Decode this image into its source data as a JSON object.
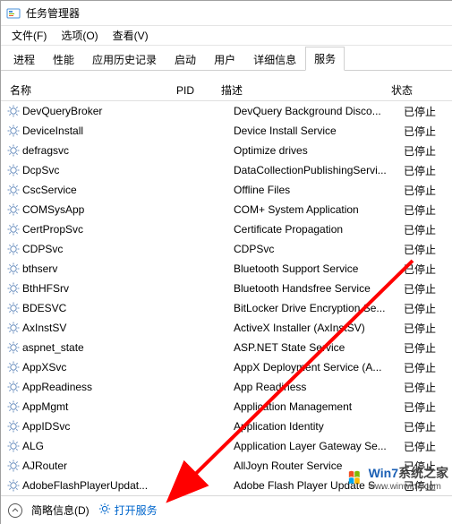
{
  "window": {
    "title": "任务管理器"
  },
  "menu": {
    "file": "文件(F)",
    "options": "选项(O)",
    "view": "查看(V)"
  },
  "tabs": {
    "processes": "进程",
    "performance": "性能",
    "history": "应用历史记录",
    "startup": "启动",
    "users": "用户",
    "details": "详细信息",
    "services": "服务"
  },
  "columns": {
    "name": "名称",
    "pid": "PID",
    "desc": "描述",
    "status": "状态"
  },
  "status_stopped": "已停止",
  "services": [
    {
      "name": "DevQueryBroker",
      "desc": "DevQuery Background Disco..."
    },
    {
      "name": "DeviceInstall",
      "desc": "Device Install Service"
    },
    {
      "name": "defragsvc",
      "desc": "Optimize drives"
    },
    {
      "name": "DcpSvc",
      "desc": "DataCollectionPublishingServi..."
    },
    {
      "name": "CscService",
      "desc": "Offline Files"
    },
    {
      "name": "COMSysApp",
      "desc": "COM+ System Application"
    },
    {
      "name": "CertPropSvc",
      "desc": "Certificate Propagation"
    },
    {
      "name": "CDPSvc",
      "desc": "CDPSvc"
    },
    {
      "name": "bthserv",
      "desc": "Bluetooth Support Service"
    },
    {
      "name": "BthHFSrv",
      "desc": "Bluetooth Handsfree Service"
    },
    {
      "name": "BDESVC",
      "desc": "BitLocker Drive Encryption Se..."
    },
    {
      "name": "AxInstSV",
      "desc": "ActiveX Installer (AxInstSV)"
    },
    {
      "name": "aspnet_state",
      "desc": "ASP.NET State Service"
    },
    {
      "name": "AppXSvc",
      "desc": "AppX Deployment Service (A..."
    },
    {
      "name": "AppReadiness",
      "desc": "App Readiness"
    },
    {
      "name": "AppMgmt",
      "desc": "Application Management"
    },
    {
      "name": "AppIDSvc",
      "desc": "Application Identity"
    },
    {
      "name": "ALG",
      "desc": "Application Layer Gateway Se..."
    },
    {
      "name": "AJRouter",
      "desc": "AllJoyn Router Service"
    },
    {
      "name": "AdobeFlashPlayerUpdat...",
      "desc": "Adobe Flash Player Update S..."
    }
  ],
  "statusbar": {
    "fewer": "简略信息(D)",
    "open_services": "打开服务"
  },
  "watermark": {
    "line1a": "Win7",
    "line1b": "系统之家",
    "line2": "www.winwin7.com"
  }
}
